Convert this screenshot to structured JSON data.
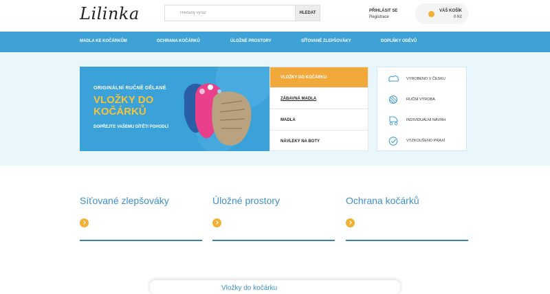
{
  "header": {
    "logo": "Lilinka",
    "search": {
      "placeholder": "Hledaný výraz",
      "button": "HLEDAT"
    },
    "login": {
      "line1": "PŘIHLÁSIT SE",
      "line2": "Registrace"
    },
    "cart": {
      "label": "VÁŠ KOŠÍK",
      "amount": "0 Kč"
    }
  },
  "nav": {
    "items": [
      "MADLA KE KOČÁRKŮM",
      "OCHRANA KOČÁRKŮ",
      "ÚLOŽNÉ PROSTORY",
      "SÍŤOVANÉ ZLEPŠOVÁKY",
      "DOPLŇKY ODĚVŮ"
    ]
  },
  "banner": {
    "line1": "ORIGINÁLNÍ RUČNĚ DĚLANÉ",
    "title": "VLOŽKY DO KOČÁRKŮ",
    "line2": "DOPŘEJTE VAŠEMU DÍTĚTI POHODLÍ"
  },
  "categories": [
    {
      "label": "VLOŽKY DO KOČÁRKU",
      "active": true
    },
    {
      "label": "ZÁBAVNÁ MADLA",
      "active": false
    },
    {
      "label": "MADLA",
      "active": false
    },
    {
      "label": "NÁVLEKY NA BOTY",
      "active": false
    }
  ],
  "benefits": [
    {
      "label": "VYROBENO V ČESKU",
      "icon": "cloud-map-icon"
    },
    {
      "label": "RUČNÍ VÝROBA",
      "icon": "yarn-icon"
    },
    {
      "label": "INDIVIDUÁLNÍ NÁVRH",
      "icon": "stroller-icon"
    },
    {
      "label": "VYZKOUŠENO PRAXÍ",
      "icon": "check-circle-icon"
    }
  ],
  "category_cards": [
    {
      "title": "Síťované zlepšováky"
    },
    {
      "title": "Úložné prostory"
    },
    {
      "title": "Ochrana kočárků"
    }
  ],
  "bottom": {
    "text": "Vložky do kočárku"
  },
  "colors": {
    "nav": "#3ea2d7",
    "accent": "#f2a93b",
    "heading": "#3e8fc8",
    "hero_bg": "#e9f7fc"
  }
}
